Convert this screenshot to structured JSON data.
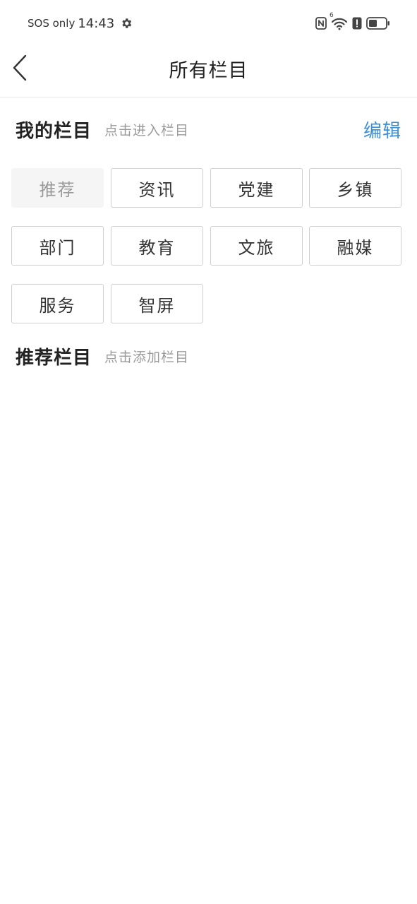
{
  "status_bar": {
    "carrier": "SOS only",
    "time": "14:43",
    "icons": [
      "gear-icon",
      "nfc-icon",
      "wifi-icon",
      "alert-icon",
      "battery-icon"
    ],
    "wifi_badge": "6"
  },
  "nav": {
    "back_icon": "chevron-left-icon",
    "title": "所有栏目"
  },
  "my_channels": {
    "title": "我的栏目",
    "hint": "点击进入栏目",
    "edit_label": "编辑",
    "items": [
      {
        "label": "推荐",
        "fixed": true
      },
      {
        "label": "资讯",
        "fixed": false
      },
      {
        "label": "党建",
        "fixed": false
      },
      {
        "label": "乡镇",
        "fixed": false
      },
      {
        "label": "部门",
        "fixed": false
      },
      {
        "label": "教育",
        "fixed": false
      },
      {
        "label": "文旅",
        "fixed": false
      },
      {
        "label": "融媒",
        "fixed": false
      },
      {
        "label": "服务",
        "fixed": false
      },
      {
        "label": "智屏",
        "fixed": false
      }
    ]
  },
  "recommended_channels": {
    "title": "推荐栏目",
    "hint": "点击添加栏目",
    "items": []
  },
  "colors": {
    "accent": "#3d8fd9",
    "fixed_chip_bg": "#f5f5f5",
    "chip_border": "#cfcfcf",
    "hint_text": "#9a9a9a"
  }
}
